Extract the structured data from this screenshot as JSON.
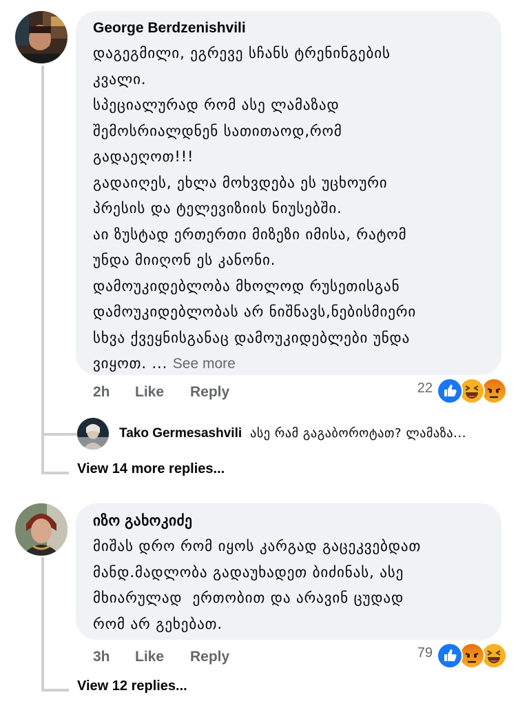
{
  "comments": [
    {
      "author": "George Berdzenishvili",
      "lines": [
        "დაგეგმილი, ეგრევე სჩანს ტრენინგების",
        "კვალი.",
        "სპეციალურად რომ ასე ლამაზად",
        "შემოსრიალდნენ სათითაოდ,რომ",
        "გადაეღოთ!!!",
        "გადაიღეს, ეხლა მოხვდება ეს უცხოური",
        "პრესის და ტელევიზიის ნიუსებში.",
        "აი ზუსტად ერთერთი მიზეზი იმისა, რატომ",
        "უნდა მიიღონ ეს კანონი.",
        "დამოუკიდებლობა მხოლოდ რუსეთისგან",
        "დამოუკიდებლობას არ ნიშნავს,ნებისმიერი",
        "სხვა ქვეყნისგანაც დამოუკიდებლები უნდა",
        "ვიყოთ. ..."
      ],
      "see_more": "See more",
      "time": "2h",
      "like_label": "Like",
      "reply_label": "Reply",
      "reaction_count": "22",
      "reactions": [
        "like-icon",
        "haha-icon",
        "angry-icon"
      ],
      "reply_preview": {
        "author": "Tako Germesashvili",
        "text": "ასე რამ გაგაბოროტათ? ლამაზა..."
      },
      "view_more": "View 14 more replies..."
    },
    {
      "author": "იზო გახოკიძე",
      "lines": [
        "მიშას დრო რომ იყოს კარგად გაცეკვებდათ",
        "მანდ.მადლობა გადაუხადეთ ბიძინას, ასე",
        "მხიარულად  ერთობით და არავინ ცუდად",
        "რომ არ გეხებათ."
      ],
      "time": "3h",
      "like_label": "Like",
      "reply_label": "Reply",
      "reaction_count": "79",
      "reactions": [
        "like-icon",
        "angry-icon",
        "haha-icon"
      ],
      "view_more": "View 12 replies..."
    }
  ],
  "colors": {
    "bubble": "#f0f2f5",
    "secondary_text": "#65676b",
    "like_blue": "#1877f2",
    "emoji_yellow": "#f7b125",
    "angry_orange": "#e9710f",
    "thread_line": "#ced0d4"
  }
}
